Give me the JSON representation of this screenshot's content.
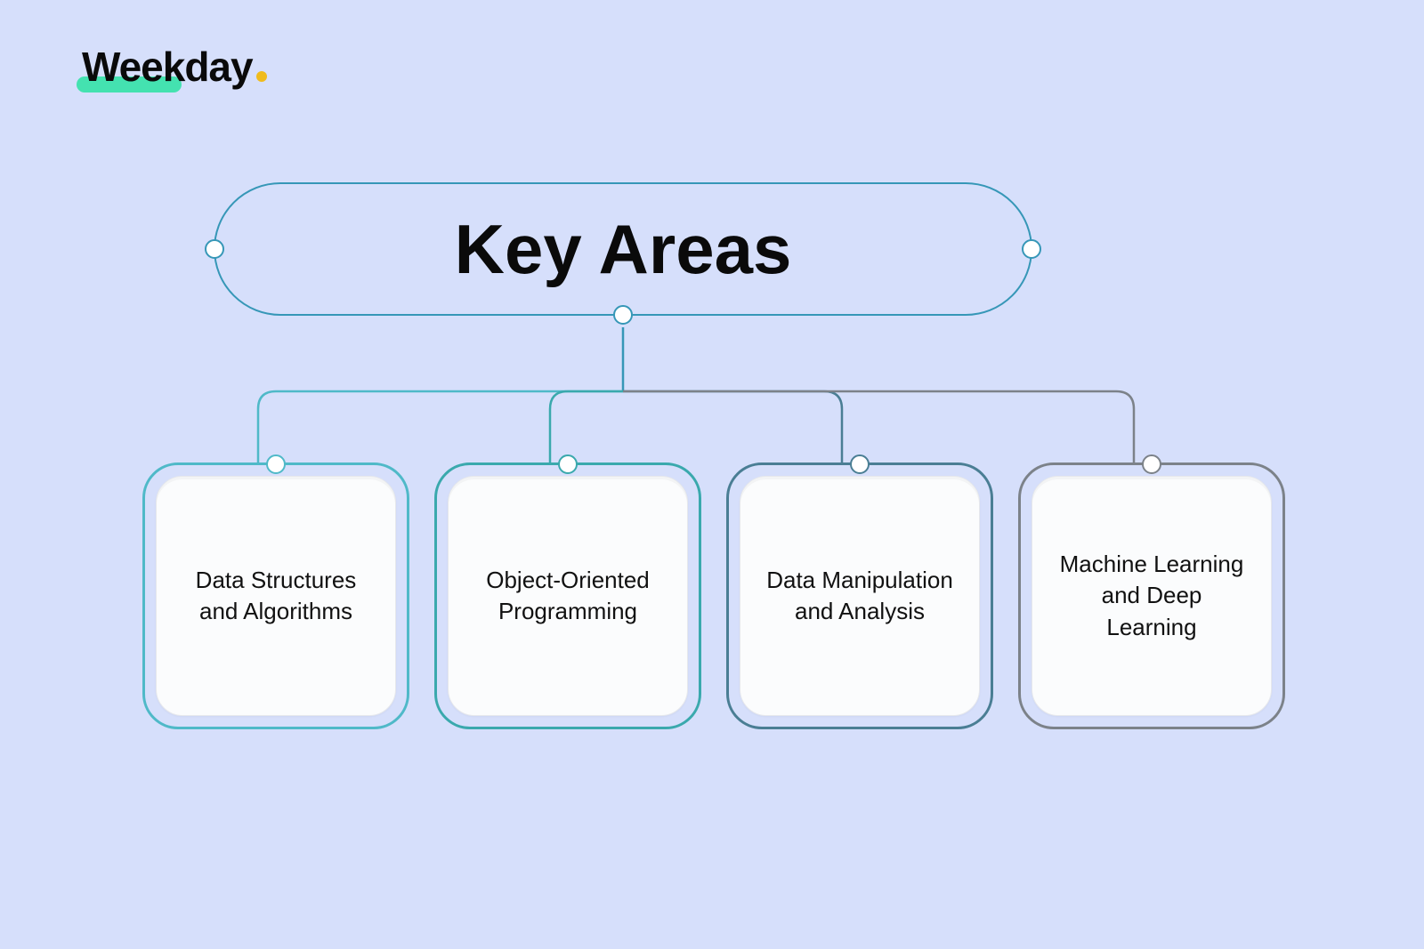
{
  "logo": {
    "text": "Weekday"
  },
  "title": "Key Areas",
  "cards": [
    {
      "label": "Data Structures and Algorithms",
      "color": "#4fb9c8"
    },
    {
      "label": "Object-Oriented Programming",
      "color": "#3aa9ad"
    },
    {
      "label": "Data Manipulation and Analysis",
      "color": "#4a7e94"
    },
    {
      "label": "Machine Learning and Deep Learning",
      "color": "#7c8289"
    }
  ]
}
